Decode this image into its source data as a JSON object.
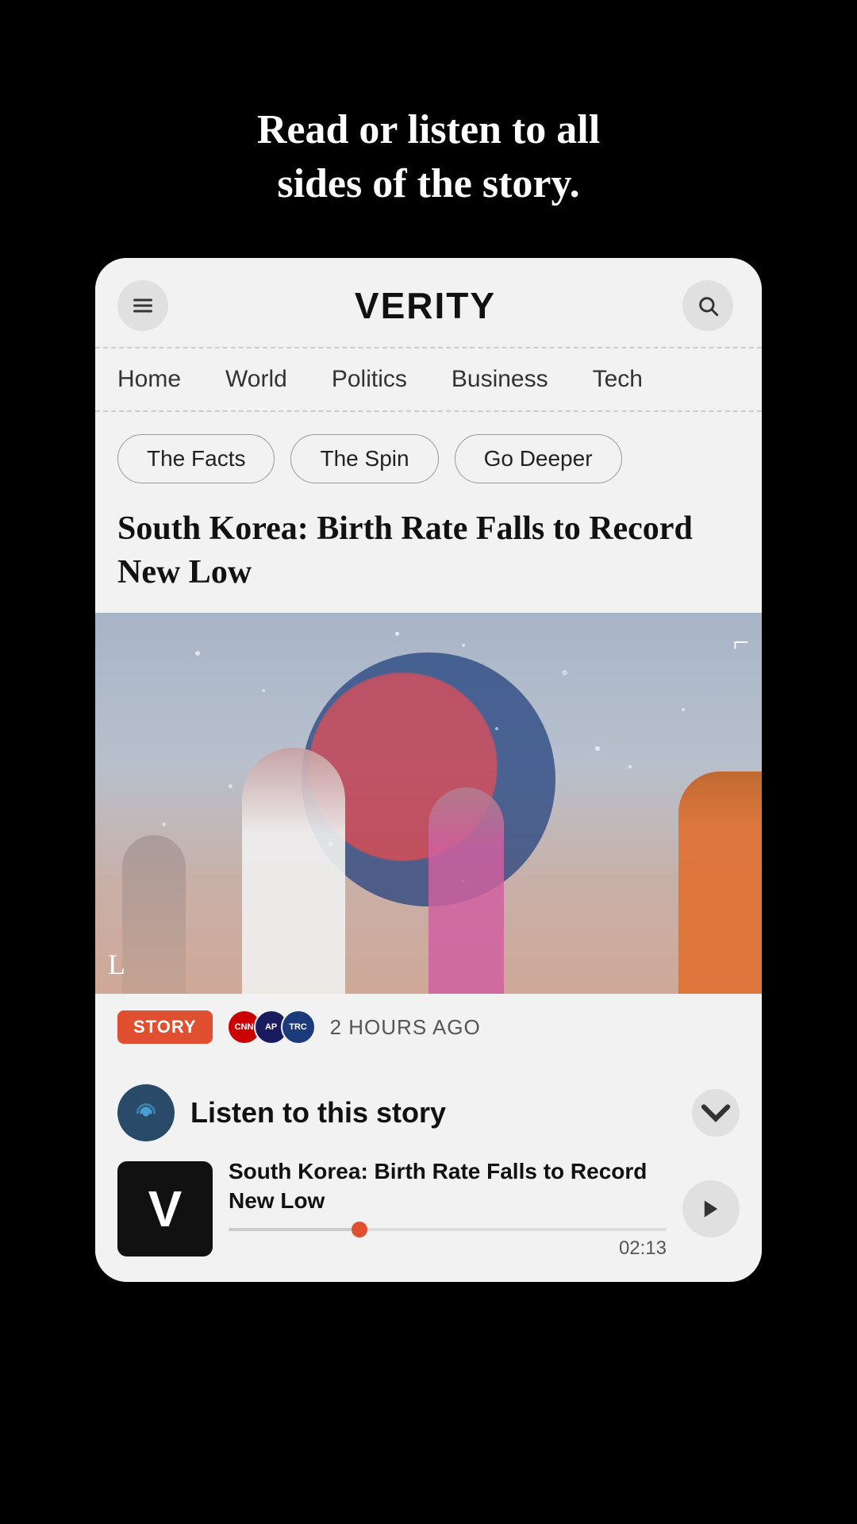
{
  "tagline": {
    "line1": "Read or listen to all",
    "line2": "sides of the story."
  },
  "header": {
    "logo": "VERITY",
    "menu_icon": "menu-icon",
    "search_icon": "search-icon"
  },
  "nav": {
    "items": [
      {
        "label": "Home",
        "id": "home"
      },
      {
        "label": "World",
        "id": "world"
      },
      {
        "label": "Politics",
        "id": "politics"
      },
      {
        "label": "Business",
        "id": "business"
      },
      {
        "label": "Tech",
        "id": "tech"
      }
    ]
  },
  "filters": {
    "pills": [
      {
        "label": "The Facts",
        "id": "facts"
      },
      {
        "label": "The Spin",
        "id": "spin"
      },
      {
        "label": "Go Deeper",
        "id": "deeper"
      }
    ]
  },
  "article": {
    "title": "South Korea: Birth Rate Falls to Record New Low"
  },
  "story_meta": {
    "badge": "STORY",
    "sources": [
      "CNN",
      "AP",
      "TRC"
    ],
    "time": "2 HOURS AGO"
  },
  "listen_section": {
    "title": "Listen to this story",
    "podcast_icon": "podcast-icon",
    "chevron_icon": "chevron-down-icon",
    "track": {
      "title": "South Korea: Birth Rate Falls to Record New Low",
      "duration": "02:13",
      "progress_percent": 30
    }
  }
}
